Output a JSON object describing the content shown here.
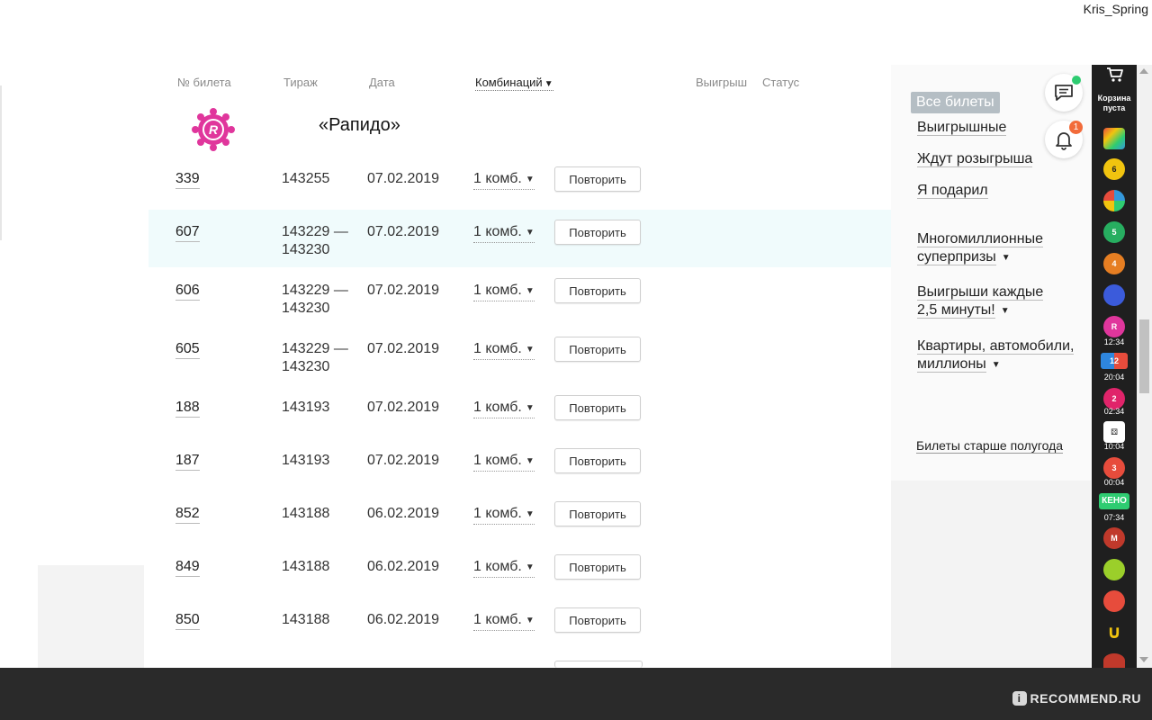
{
  "user": {
    "name": "Kris_Spring"
  },
  "table": {
    "headers": {
      "ticket": "№ билета",
      "draw": "Тираж",
      "date": "Дата",
      "combinations": "Комбинаций",
      "win": "Выигрыш",
      "status": "Статус"
    },
    "game_title": "«Рапидо»",
    "repeat_label": "Повторить",
    "rows": [
      {
        "ticket": "339",
        "draw": "143255",
        "date": "07.02.2019",
        "combo": "1 комб."
      },
      {
        "ticket": "607",
        "draw": "143229 —",
        "draw2": "143230",
        "date": "07.02.2019",
        "combo": "1 комб."
      },
      {
        "ticket": "606",
        "draw": "143229 —",
        "draw2": "143230",
        "date": "07.02.2019",
        "combo": "1 комб."
      },
      {
        "ticket": "605",
        "draw": "143229 —",
        "draw2": "143230",
        "date": "07.02.2019",
        "combo": "1 комб."
      },
      {
        "ticket": "188",
        "draw": "143193",
        "date": "07.02.2019",
        "combo": "1 комб."
      },
      {
        "ticket": "187",
        "draw": "143193",
        "date": "07.02.2019",
        "combo": "1 комб."
      },
      {
        "ticket": "852",
        "draw": "143188",
        "date": "06.02.2019",
        "combo": "1 комб."
      },
      {
        "ticket": "849",
        "draw": "143188",
        "date": "06.02.2019",
        "combo": "1 комб."
      },
      {
        "ticket": "850",
        "draw": "143188",
        "date": "06.02.2019",
        "combo": "1 комб."
      }
    ]
  },
  "filters": {
    "all": "Все билеты",
    "winning": "Выигрышные",
    "waiting": "Ждут розыгрыша",
    "gifted": "Я подарил",
    "multimillion_1": "Многомиллионные",
    "multimillion_2": "суперпризы",
    "every_2_5_1": "Выигрыши каждые",
    "every_2_5_2": "2,5 минуты!",
    "apartments_1": "Квартиры, автомобили,",
    "apartments_2": "миллионы",
    "older": "Билеты старше полугода"
  },
  "notifications": {
    "count": "1"
  },
  "sidebar": {
    "cart_label_1": "Корзина",
    "cart_label_2": "пуста",
    "times": [
      "12:34",
      "20:04",
      "02:34",
      "10:04",
      "00:04",
      "07:34"
    ],
    "icon_texts": [
      "5",
      "4",
      "12",
      "2",
      "3",
      "КЕНО",
      "M"
    ]
  },
  "colors": {
    "accent_pink": "#e0369c",
    "highlight_row": "#f0fbfc",
    "active_filter": "#b5bec4",
    "badge_orange": "#f26b3a",
    "badge_green": "#2ecc71"
  },
  "watermark": {
    "text": "RECOMMEND.RU",
    "badge": "i"
  }
}
